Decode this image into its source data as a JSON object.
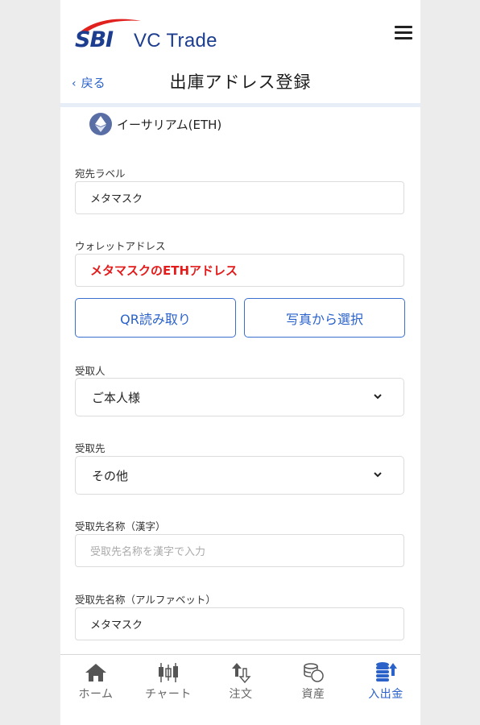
{
  "header": {
    "logo_sbi": "SBI",
    "logo_vc_trade": "VC Trade",
    "back_label": "戻る",
    "title": "出庫アドレス登録"
  },
  "coin": {
    "name": "イーサリアム(ETH)",
    "icon": "ethereum-icon"
  },
  "form": {
    "destination_label": {
      "label": "宛先ラベル",
      "value": "メタマスク"
    },
    "wallet_address": {
      "label": "ウォレットアドレス",
      "value": "メタマスクのETHアドレス",
      "color": "#e31b1b"
    },
    "qr_button": "QR読み取り",
    "photo_button": "写真から選択",
    "recipient": {
      "label": "受取人",
      "value": "ご本人様"
    },
    "receiver": {
      "label": "受取先",
      "value": "その他"
    },
    "receiver_name_kanji": {
      "label": "受取先名称（漢字）",
      "placeholder": "受取先名称を漢字で入力"
    },
    "receiver_name_alpha": {
      "label": "受取先名称（アルファベット）",
      "value": "メタマスク"
    }
  },
  "tabbar": {
    "items": [
      {
        "label": "ホーム",
        "icon": "home-icon",
        "active": false
      },
      {
        "label": "チャート",
        "icon": "chart-icon",
        "active": false
      },
      {
        "label": "注文",
        "icon": "order-icon",
        "active": false
      },
      {
        "label": "資産",
        "icon": "assets-icon",
        "active": false
      },
      {
        "label": "入出金",
        "icon": "deposit-withdraw-icon",
        "active": true
      }
    ]
  },
  "colors": {
    "accent": "#2a62c9",
    "brand": "#1d3e8f",
    "logo_red": "#e0211d",
    "highlight": "#e31b1b"
  }
}
